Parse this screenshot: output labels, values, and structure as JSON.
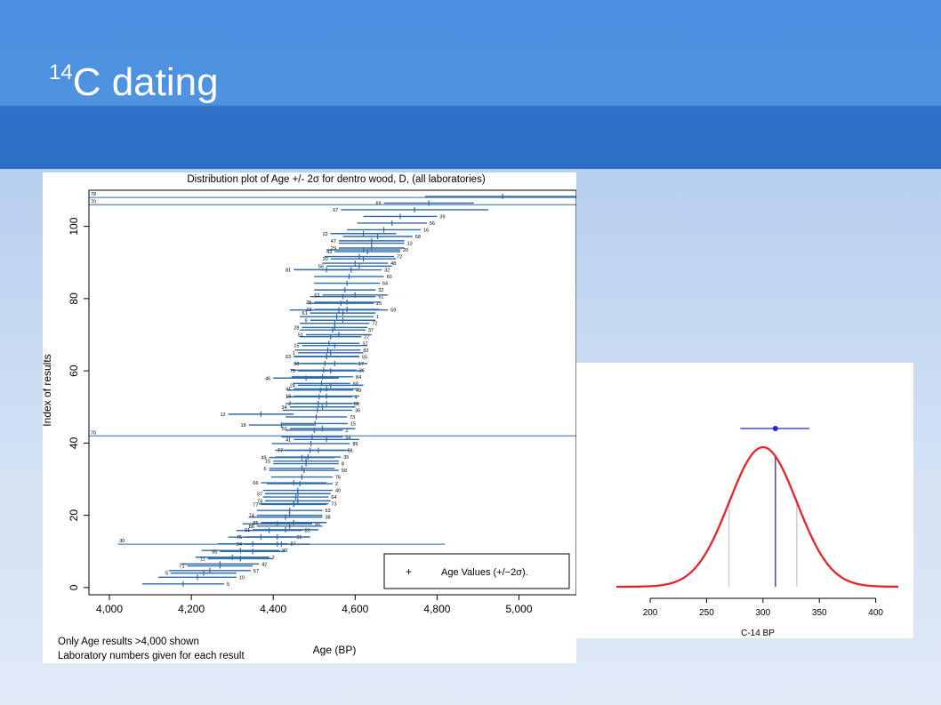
{
  "slide": {
    "title_superscript": "14",
    "title_main": "C dating",
    "colors": {
      "header": "#4a8fe0",
      "header_dark": "#2d6ec5",
      "title_text": "#ffffff"
    }
  },
  "chart_data": [
    {
      "type": "scatter",
      "title": "Distribution plot of Age +/- 2σ for dentro wood, D, (all laboratories)",
      "xlabel": "Age (BP)",
      "ylabel": "Index of results",
      "xlim": [
        3950,
        5140
      ],
      "ylim": [
        -2,
        110
      ],
      "xticks": [
        4000,
        4200,
        4400,
        4600,
        4800,
        5000
      ],
      "xtick_labels": [
        "4,000",
        "4,200",
        "4,400",
        "4,600",
        "4,800",
        "5,000"
      ],
      "yticks": [
        0,
        20,
        40,
        60,
        80,
        100
      ],
      "yticks_labels": [
        "0",
        "20",
        "40",
        "60",
        "80",
        "100"
      ],
      "legend": {
        "text": "Age Values (+/−2σ).",
        "marker": "+",
        "position": "bottom-right"
      },
      "notes": [
        "Only Age results >4,000 shown",
        "Laboratory numbers given for each result"
      ],
      "color": "#2e6aa8",
      "min_index": 1,
      "index_step": 1,
      "labels": [
        "5",
        "10",
        "57",
        "42",
        "7",
        "90",
        "87",
        "31",
        "85",
        "90",
        "38",
        "63",
        "73",
        "64",
        "40",
        "2",
        "76",
        "58",
        "8",
        "35",
        "51",
        "89",
        "54",
        "2",
        "15",
        "73",
        "36",
        "88",
        "4",
        "49",
        "68",
        "84",
        "36",
        "17",
        "55",
        "82",
        "37",
        "27",
        "37",
        "72",
        "1",
        "59",
        "25",
        "51",
        "32",
        "64",
        "60",
        "32",
        "48",
        "72",
        "20",
        "13",
        "68",
        "16",
        "56",
        "39",
        "67",
        "69",
        "78"
      ],
      "center": [
        4180,
        4215,
        4245,
        4270,
        4300,
        4320,
        4350,
        4370,
        4390,
        4410,
        4430,
        4440,
        4450,
        4455,
        4460,
        4465,
        4470,
        4475,
        4480,
        4485,
        4490,
        4492,
        4495,
        4500,
        4502,
        4505,
        4508,
        4510,
        4512,
        4515,
        4518,
        4520,
        4523,
        4526,
        4530,
        4533,
        4536,
        4540,
        4545,
        4550,
        4555,
        4560,
        4565,
        4570,
        4575,
        4580,
        4585,
        4590,
        4600,
        4610,
        4620,
        4640,
        4655,
        4670,
        4690,
        4710,
        4745,
        4780,
        4960
      ],
      "error": [
        100,
        95,
        100,
        95,
        90,
        95,
        85,
        80,
        80,
        85,
        90,
        80,
        85,
        80,
        85,
        80,
        75,
        85,
        80,
        80,
        85,
        95,
        75,
        70,
        80,
        75,
        85,
        80,
        80,
        80,
        70,
        75,
        80,
        75,
        80,
        80,
        75,
        75,
        80,
        85,
        90,
        120,
        80,
        80,
        75,
        80,
        85,
        75,
        80,
        85,
        90,
        80,
        85,
        90,
        85,
        90,
        180,
        110,
        190
      ],
      "label_side": [
        "r",
        "r",
        "r",
        "r",
        "r",
        "r",
        "r",
        "r",
        "r",
        "r",
        "r",
        "r",
        "r",
        "r",
        "r",
        "r",
        "r",
        "r",
        "r",
        "r",
        "r",
        "r",
        "r",
        "r",
        "r",
        "r",
        "r",
        "r",
        "r",
        "r",
        "r",
        "r",
        "r",
        "r",
        "r",
        "r",
        "r",
        "r",
        "r",
        "r",
        "r",
        "r",
        "r",
        "r",
        "r",
        "r",
        "r",
        "r",
        "r",
        "r",
        "r",
        "r",
        "r",
        "r",
        "r",
        "r",
        "l",
        "l",
        "r"
      ],
      "extra_labels_left": [
        "5",
        "71",
        "11",
        "55",
        "34",
        "75",
        "91",
        "88",
        "85",
        "74",
        "77",
        "74",
        "37",
        "66",
        "6",
        "15",
        "49",
        "77",
        "41",
        "50",
        "18",
        "12",
        "34",
        "2",
        "19",
        "41",
        "24",
        "46",
        "79",
        "50",
        "63",
        "1",
        "15",
        "51",
        "28",
        "9",
        "61",
        "23",
        "25",
        "63",
        "81",
        "56",
        "20",
        "43",
        "29",
        "47",
        "22"
      ],
      "extra_left_index": [
        4,
        6,
        8,
        10,
        12,
        14,
        16,
        17,
        18,
        20,
        23,
        24,
        26,
        29,
        33,
        35,
        36,
        38,
        41,
        44,
        45,
        48,
        50,
        51,
        53,
        55,
        56,
        58,
        60,
        62,
        64,
        65,
        67,
        70,
        72,
        74,
        76,
        77,
        79,
        81,
        88,
        89,
        91,
        93,
        94,
        96,
        98
      ],
      "extra_left_x": [
        4150,
        4190,
        4240,
        4270,
        4330,
        4330,
        4350,
        4360,
        4370,
        4360,
        4370,
        4380,
        4380,
        4370,
        4390,
        4400,
        4390,
        4430,
        4450,
        4440,
        4340,
        4290,
        4440,
        4450,
        4450,
        4450,
        4460,
        4400,
        4460,
        4470,
        4450,
        4460,
        4470,
        4480,
        4470,
        4490,
        4490,
        4500,
        4500,
        4520,
        4450,
        4530,
        4540,
        4550,
        4560,
        4560,
        4540
      ],
      "thin_lines": [
        {
          "y": 42,
          "x1": 3950,
          "x2": 5140,
          "label": "70"
        },
        {
          "y": 106,
          "x1": 3950,
          "x2": 5140,
          "label": "70"
        },
        {
          "y": 108,
          "x1": 3950,
          "x2": 5140,
          "label": "78"
        },
        {
          "y": 12,
          "x1": 4020,
          "x2": 4820,
          "label": "30",
          "center": 4420
        }
      ]
    },
    {
      "type": "line",
      "xlabel": "C-14 BP",
      "xlim": [
        170,
        420
      ],
      "xticks": [
        200,
        250,
        300,
        350,
        400
      ],
      "xtick_labels": [
        "200",
        "250",
        "300",
        "350",
        "400"
      ],
      "curve": {
        "shape": "normal",
        "mean": 300,
        "sd": 30,
        "color": "#e8242a"
      },
      "measurement": {
        "value": 311,
        "error_low": 280,
        "error_high": 341,
        "color": "#2323d6"
      },
      "sigma_lines": [
        270,
        330
      ],
      "sigma_color": "#b8b8b8"
    }
  ]
}
